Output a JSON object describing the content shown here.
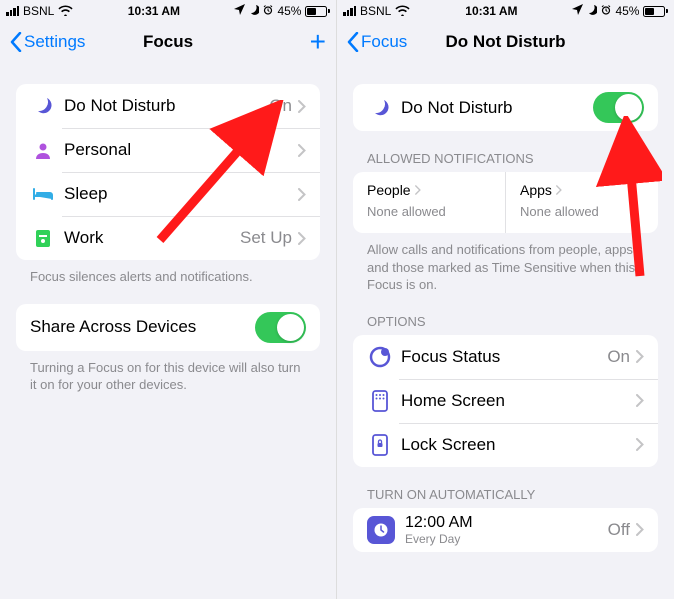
{
  "status": {
    "carrier": "BSNL",
    "time": "10:31 AM",
    "battery_pct": "45%"
  },
  "left": {
    "nav_back": "Settings",
    "title": "Focus",
    "items": [
      {
        "label": "Do Not Disturb",
        "value": "On"
      },
      {
        "label": "Personal",
        "value": ""
      },
      {
        "label": "Sleep",
        "value": ""
      },
      {
        "label": "Work",
        "value": "Set Up"
      }
    ],
    "footer1": "Focus silences alerts and notifications.",
    "share_label": "Share Across Devices",
    "footer2": "Turning a Focus on for this device will also turn it on for your other devices."
  },
  "right": {
    "nav_back": "Focus",
    "title": "Do Not Disturb",
    "toggle_label": "Do Not Disturb",
    "allowed_header": "Allowed Notifications",
    "people": {
      "title": "People",
      "sub": "None allowed"
    },
    "apps": {
      "title": "Apps",
      "sub": "None allowed"
    },
    "allowed_footer": "Allow calls and notifications from people, apps and those marked as Time Sensitive when this Focus is on.",
    "options_header": "Options",
    "options": [
      {
        "label": "Focus Status",
        "value": "On"
      },
      {
        "label": "Home Screen",
        "value": ""
      },
      {
        "label": "Lock Screen",
        "value": ""
      }
    ],
    "auto_header": "Turn On Automatically",
    "schedule": {
      "time": "12:00 AM",
      "repeat": "Every Day",
      "value": "Off"
    }
  }
}
